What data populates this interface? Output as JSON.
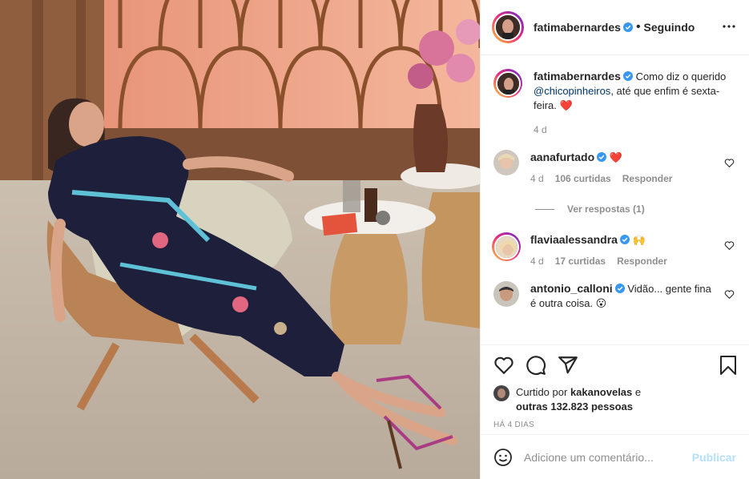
{
  "post": {
    "username": "fatimabernardes",
    "follow_separator": "•",
    "follow_status": "Seguindo",
    "caption_pre": "Como diz o querido",
    "caption_mention": "@chicopinheiros",
    "caption_post": ", até que enfim é sexta-feira.",
    "caption_emoji": "❤️",
    "caption_age": "4 d"
  },
  "comments": [
    {
      "username": "aanafurtado",
      "text": "",
      "emoji": "❤️",
      "age": "4 d",
      "likes": "106 curtidas",
      "reply": "Responder",
      "replies_label": "Ver respostas (1)"
    },
    {
      "username": "flaviaalessandra",
      "text": "",
      "emoji": "🙌",
      "age": "4 d",
      "likes": "17 curtidas",
      "reply": "Responder"
    },
    {
      "username": "antonio_calloni",
      "text": "Vidão... gente fina é outra coisa.",
      "emoji": "😮"
    }
  ],
  "liked_by": {
    "prefix": "Curtido por",
    "user": "kakanovelas",
    "conj": "e",
    "others": "outras 132.823 pessoas"
  },
  "date_label": "HÁ 4 DIAS",
  "add_comment": {
    "placeholder": "Adicione um comentário...",
    "publish": "Publicar"
  },
  "colors": {
    "verified": "#3897f0",
    "link": "#00376b",
    "publish_disabled": "#b2dffc",
    "meta": "#8e8e8e"
  }
}
